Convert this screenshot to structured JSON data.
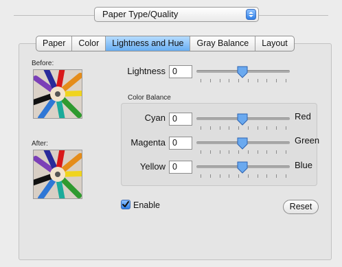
{
  "popup": {
    "value": "Paper Type/Quality"
  },
  "tabs": [
    {
      "label": "Paper",
      "active": false
    },
    {
      "label": "Color",
      "active": false
    },
    {
      "label": "Lightness and Hue",
      "active": true
    },
    {
      "label": "Gray Balance",
      "active": false
    },
    {
      "label": "Layout",
      "active": false
    }
  ],
  "preview": {
    "before_label": "Before:",
    "after_label": "After:"
  },
  "lightness": {
    "label": "Lightness",
    "value": "0",
    "level": 0.5
  },
  "color_balance": {
    "title": "Color Balance",
    "rows": [
      {
        "left_label": "Cyan",
        "value": "0",
        "right_label": "Red",
        "level": 0.5
      },
      {
        "left_label": "Magenta",
        "value": "0",
        "right_label": "Green",
        "level": 0.5
      },
      {
        "left_label": "Yellow",
        "value": "0",
        "right_label": "Blue",
        "level": 0.5
      }
    ]
  },
  "enable": {
    "label": "Enable",
    "checked": true
  },
  "reset": {
    "label": "Reset"
  },
  "colors": {
    "accent": "#4a90e2",
    "panel": "#e5e5e5",
    "tab_active": "#7bb8f3"
  }
}
